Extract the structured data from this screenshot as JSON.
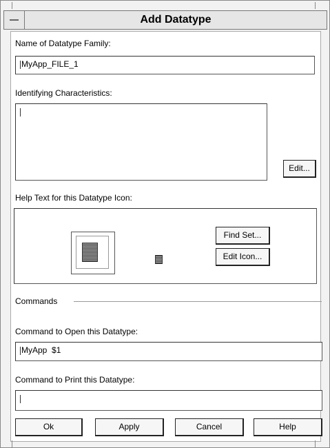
{
  "window": {
    "title": "Add Datatype"
  },
  "name_field": {
    "label": "Name of Datatype Family:",
    "value": "MyApp_FILE_1"
  },
  "characteristics": {
    "label": "Identifying Characteristics:",
    "value": "",
    "edit_button": "Edit..."
  },
  "help_text": {
    "label": "Help Text for this Datatype Icon:",
    "find_set_button": "Find Set...",
    "edit_icon_button": "Edit Icon..."
  },
  "commands": {
    "group_label": "Commands"
  },
  "open_command": {
    "label": "Command to Open this Datatype:",
    "value": "MyApp  $1"
  },
  "print_command": {
    "label": "Command to Print this Datatype:",
    "value": ""
  },
  "buttons": {
    "ok": "Ok",
    "apply": "Apply",
    "cancel": "Cancel",
    "help": "Help"
  }
}
